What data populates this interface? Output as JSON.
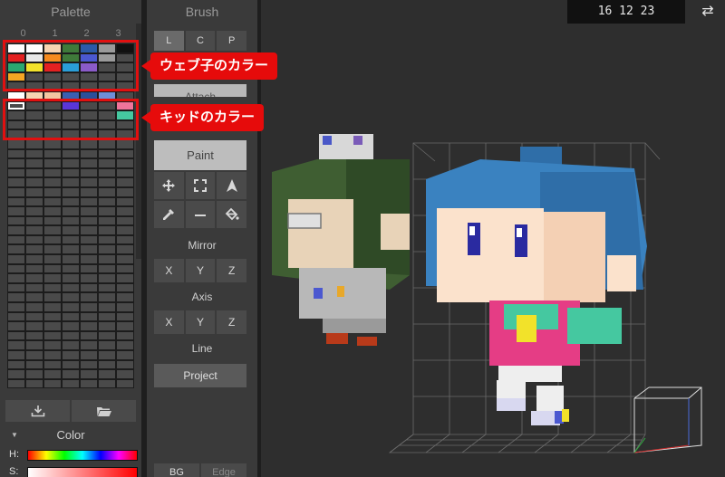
{
  "palette": {
    "title": "Palette",
    "column_headers": [
      "0",
      "1",
      "2",
      "3"
    ],
    "rows": [
      [
        "#ffffff",
        "#ffffff",
        "#f6d4b2",
        "#3f7a3a",
        "#2c5aa8",
        "#9a9a9a",
        "#111111"
      ],
      [
        "#e42121",
        "#e8e8e8",
        "#f58a1e",
        "#3f7a3a",
        "#4b58d0",
        "#9a9a9a",
        "#4a4a4a"
      ],
      [
        "#2aa870",
        "#f2e22a",
        "#e42121",
        "#2a9ed8",
        "#8a5bc8",
        "#4a4a4a",
        "#4a4a4a"
      ],
      [
        "#f5a623",
        "#4a4a4a",
        "#4a4a4a",
        "#4a4a4a",
        "#4a4a4a",
        "#4a4a4a",
        "#4a4a4a"
      ],
      [
        "#4a4a4a",
        "#4a4a4a",
        "#4a4a4a",
        "#4a4a4a",
        "#4a4a4a",
        "#4a4a4a",
        "#4a4a4a"
      ],
      [
        "#ffffff",
        "#f6d4b2",
        "#f3c6a2",
        "#3c5fb0",
        "#2a4f9a",
        "#6f8fd8",
        "#4a4a4a"
      ],
      [
        "#4a4a4a",
        "#4a4a4a",
        "#4a4a4a",
        "#5a36d8",
        "#4a4a4a",
        "#4a4a4a",
        "#f0749a"
      ],
      [
        "#4a4a4a",
        "#4a4a4a",
        "#4a4a4a",
        "#4a4a4a",
        "#4a4a4a",
        "#4a4a4a",
        "#45c8a0"
      ]
    ],
    "selected": [
      6,
      0
    ]
  },
  "annotations": {
    "web_colors": "ウェブ子のカラー",
    "kid_colors": "キッドのカラー",
    "accent": "#e60b0b"
  },
  "color": {
    "header": "Color",
    "h_label": "H:",
    "s_label": "S:"
  },
  "brush": {
    "title": "Brush",
    "modes": [
      "L",
      "C",
      "P"
    ],
    "attach_label": "Attach",
    "paint_label": "Paint",
    "tools": [
      "move-icon",
      "select-box-icon",
      "cursor-icon",
      "eyedropper-icon",
      "line-tool-icon",
      "fill-bucket-icon"
    ],
    "mirror_label": "Mirror",
    "axis_label": "Axis",
    "xyz": [
      "X",
      "Y",
      "Z"
    ],
    "line_label": "Line",
    "project_label": "Project",
    "bg_label": "BG",
    "edge_label": "Edge"
  },
  "viewport": {
    "coordinates": "16 12 23",
    "swap_icon": "swap-icon"
  }
}
